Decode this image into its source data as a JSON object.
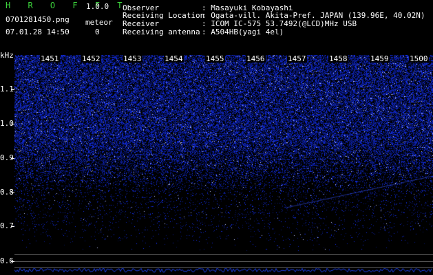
{
  "app": {
    "title": "H R O F F T",
    "version": "1.0.0"
  },
  "file": {
    "name": "0701281450.png",
    "datetime": "07.01.28 14:50"
  },
  "meteor": {
    "label": "meteor",
    "count": "0"
  },
  "meta": {
    "rows": [
      {
        "label": "Observer",
        "value": ": Masayuki Kobayashi"
      },
      {
        "label": "Receiving Location",
        "value": ": Ogata-vill. Akita-Pref. JAPAN (139.96E, 40.02N)"
      },
      {
        "label": "Receiver",
        "value": ": ICOM IC-575 53.7492(@LCD)MHz USB"
      },
      {
        "label": "Receiving antenna",
        "value": ": A504HB(yagi 4el)"
      }
    ]
  },
  "axis": {
    "unit": "kHz",
    "yticks": [
      "1.1",
      "1.0",
      "0.9",
      "0.8",
      "0.7",
      "0.6"
    ],
    "minutes": [
      "1451",
      "1452",
      "1453",
      "1454",
      "1455",
      "1456",
      "1457",
      "1458",
      "1459",
      "1500"
    ]
  },
  "colors": {
    "signal": "#1e3cff",
    "title": "#3cd23c"
  }
}
